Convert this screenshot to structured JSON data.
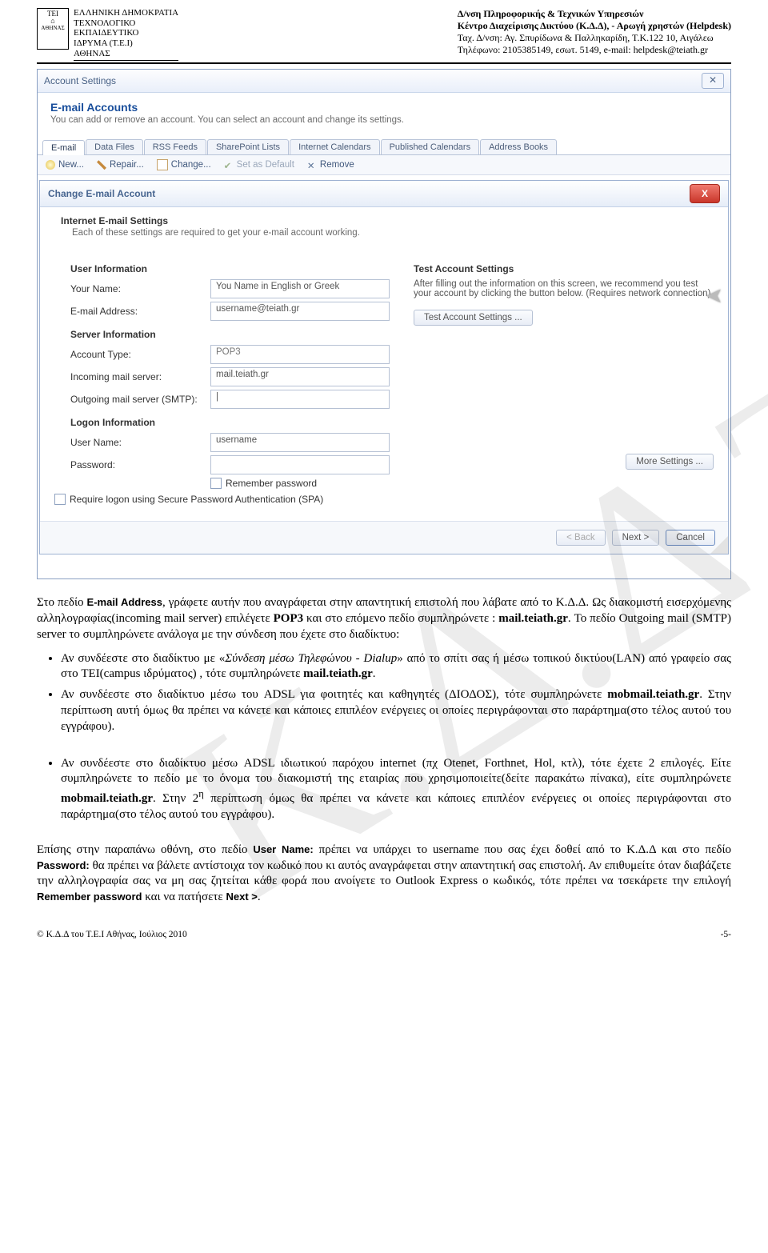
{
  "header": {
    "org_lines": [
      "ΕΛΛΗΝΙΚΗ ΔΗΜΟΚΡΑΤΙΑ",
      "ΤΕΧΝΟΛΟΓΙΚΟ",
      "ΕΚΠΑΙΔΕΥΤΙΚΟ",
      "ΙΔΡΥΜΑ (Τ.Ε.Ι)",
      "ΑΘΗΝΑΣ"
    ],
    "logo_lines": [
      "TEI",
      "⌂",
      "AΘHNAΣ"
    ],
    "dept1": "Δ/νση Πληροφορικής & Τεχνικών Υπηρεσιών",
    "dept2": "Κέντρο Διαχείρισης Δικτύου (Κ.Δ.Δ), - Αρωγή χρηστών (Helpdesk)",
    "addr": "Ταχ. Δ/νση: Αγ. Σπυρίδωνα & Παλληκαρίδη, Τ.Κ.122 10, Αιγάλεω",
    "tel": "Τηλέφωνο: 2105385149, εσωτ. 5149,  e-mail: helpdesk@teiath.gr"
  },
  "win1": {
    "title": "Account Settings",
    "h1": "E-mail Accounts",
    "sub": "You can add or remove an account. You can select an account and change its settings.",
    "tabs": [
      "E-mail",
      "Data Files",
      "RSS Feeds",
      "SharePoint Lists",
      "Internet Calendars",
      "Published Calendars",
      "Address Books"
    ],
    "toolbar": {
      "new": "New...",
      "repair": "Repair...",
      "change": "Change...",
      "default": "Set as Default",
      "remove": "Remove"
    }
  },
  "win2": {
    "title": "Change E-mail Account",
    "h1": "Internet E-mail Settings",
    "sub": "Each of these settings are required to get your e-mail account working.",
    "sec_user": "User Information",
    "your_name_lbl": "Your Name:",
    "your_name_val": "You Name in English or Greek",
    "email_lbl": "E-mail Address:",
    "email_val": "username@teiath.gr",
    "sec_server": "Server Information",
    "acct_type_lbl": "Account Type:",
    "acct_type_val": "POP3",
    "in_lbl": "Incoming mail server:",
    "in_val": "mail.teiath.gr",
    "out_lbl": "Outgoing mail server (SMTP):",
    "out_val": "|",
    "sec_logon": "Logon Information",
    "user_lbl": "User Name:",
    "user_val": "username",
    "pass_lbl": "Password:",
    "remember": "Remember password",
    "spa": "Require logon using Secure Password Authentication (SPA)",
    "test_title": "Test Account Settings",
    "test_text": "After filling out the information on this screen, we recommend you test your account by clicking the button below. (Requires network connection)",
    "test_btn": "Test Account Settings ...",
    "more": "More Settings ...",
    "back": "< Back",
    "next": "Next >",
    "cancel": "Cancel"
  },
  "body": {
    "p1a": "Στο πεδίο ",
    "p1b": "E-mail Address",
    "p1c": ", γράφετε αυτήν που αναγράφεται στην απαντητική επιστολή που λάβατε από το Κ.Δ.Δ. Ως διακομιστή εισερχόμενης αλληλογραφίας(incoming mail server) επιλέγετε ",
    "p1d": "POP3",
    "p1e": " και στο επόμενο πεδίο συμπληρώνετε : ",
    "p1f": "mail.teiath.gr",
    "p1g": ". Το πεδίο Outgoing mail (SMTP) server το συμπληρώνετε ανάλογα με την σύνδεση που έχετε στο διαδίκτυο:",
    "li1a": "Αν συνδέεστε στο διαδίκτυο με «",
    "li1b": "Σύνδεση μέσω Τηλεφώνου - Dialup",
    "li1c": "»  από το σπίτι σας ή μέσω τοπικού δικτύου(LAN) από γραφείο σας στο TEI(campus ιδρύματος) , τότε συμπληρώνετε ",
    "li1d": "mail.teiath.gr",
    "li1e": ".",
    "li2a": "Αν συνδέεστε στο διαδίκτυο μέσω του ADSL για φοιτητές και καθηγητές (ΔΙΟΔΟΣ), τότε  συμπληρώνετε ",
    "li2b": "mobmail.teiath.gr",
    "li2c": ". Στην περίπτωση αυτή όμως θα πρέπει να κάνετε και κάποιες επιπλέον ενέργειες οι οποίες περιγράφονται στο παράρτημα(στο τέλος αυτού του εγγράφου).",
    "li3a": "Αν συνδέεστε στο διαδίκτυο μέσω ADSL ιδιωτικού παρόχου internet (πχ Otenet, Forthnet, Hol, κτλ), τότε έχετε 2 επιλογές. Είτε συμπληρώνετε το πεδίο με το όνομα του διακομιστή της εταιρίας που χρησιμοποιείτε(δείτε παρακάτω πίνακα), είτε συμπληρώνετε ",
    "li3b": "mobmail.teiath.gr",
    "li3c": ". Στην 2",
    "li3sup": "η",
    "li3d": " περίπτωση  όμως θα πρέπει να κάνετε και κάποιες επιπλέον ενέργειες οι οποίες περιγράφονται στο παράρτημα(στο τέλος αυτού του εγγράφου).",
    "p2a": "Επίσης στην παραπάνω οθόνη, στο πεδίο ",
    "p2b": "User Name:",
    "p2c": " πρέπει να υπάρχει το username που σας έχει δοθεί από το Κ.Δ.Δ και στο πεδίο ",
    "p2d": "Password:",
    "p2e": " θα πρέπει να βάλετε αντίστοιχα τον κωδικό που κι αυτός αναγράφεται στην απαντητική σας επιστολή. Αν επιθυμείτε όταν διαβάζετε την αλληλογραφία σας να μη σας ζητείται κάθε φορά που ανοίγετε το Outlook Express ο κωδικός, τότε πρέπει να τσεκάρετε την επιλογή ",
    "p2f": "Remember password",
    "p2g": " και να πατήσετε ",
    "p2h": "Next >",
    "p2i": "."
  },
  "footer": {
    "left": "© Κ.Δ.Δ του Τ.Ε.Ι Αθήνας, Ιούλιος 2010",
    "right": "-5-"
  }
}
